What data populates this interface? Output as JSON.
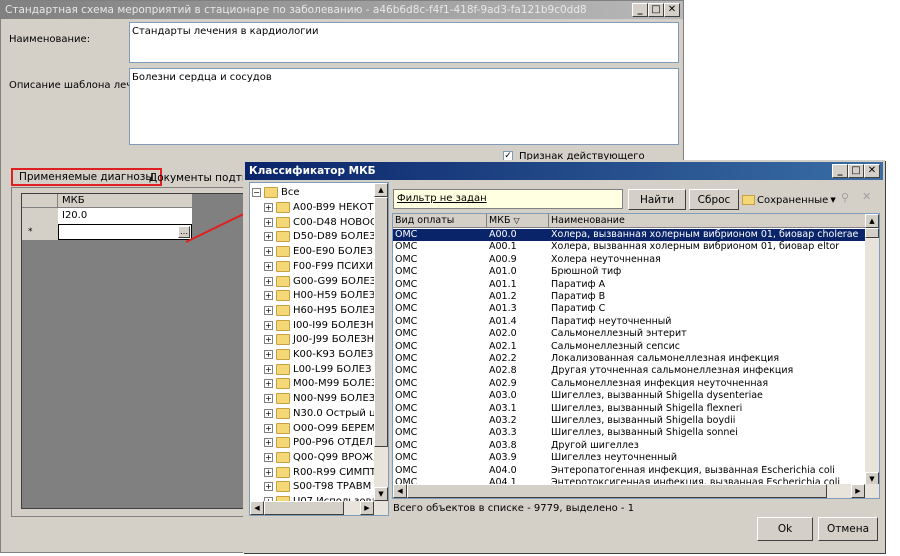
{
  "main_window": {
    "title": "Стандартная схема мероприятий в стационаре по заболеванию - a46b6d8c-f4f1-418f-9ad3-fa121b9c0dd8",
    "name_label": "Наименование:",
    "name_value": "Стандарты лечения в кардиологии",
    "desc_label": "Описание шаблона лечения:",
    "desc_value": "Болезни сердца и сосудов",
    "active_checkbox_label": "Признак действующего шаблона",
    "tabs": [
      "Применяемые диагнозы",
      "Документы подтверж"
    ],
    "grid_header": "МКБ",
    "grid_rows": [
      "I20.0"
    ],
    "new_row_marker": "*"
  },
  "dialog": {
    "title": "Классификатор МКБ",
    "tree_root": "Все",
    "tree_items": [
      "A00-B99 НЕКОТ",
      "C00-D48 НОВОО",
      "D50-D89 БОЛЕЗ",
      "E00-E90 БОЛЕЗ",
      "F00-F99 ПСИХИ",
      "G00-G99 БОЛЕЗ",
      "H00-H59 БОЛЕЗ",
      "H60-H95 БОЛЕЗ",
      "I00-I99 БОЛЕЗН",
      "J00-J99 БОЛЕЗН",
      "K00-K93 БОЛЕЗ",
      "L00-L99 БОЛЕЗ",
      "M00-M99 БОЛЕЗ",
      "N00-N99 БОЛЕЗ",
      "N30.0 Острый ц",
      "O00-O99 БЕРЕМ",
      "P00-P96 ОТДЕЛ",
      "Q00-Q99 ВРОЖ,",
      "R00-R99 СИМПТ",
      "S00-T98 ТРАВМ",
      "U07 Использова"
    ],
    "filter_text": "Фильтр не задан",
    "find_button": "Найти",
    "reset_button": "Сброс",
    "saved_button": "Сохраненные",
    "columns": [
      "Вид оплаты",
      "МКБ",
      "Наименование"
    ],
    "rows": [
      [
        "ОМС",
        "A00.0",
        "Холера, вызванная холерным вибрионом 01, биовар cholerae"
      ],
      [
        "ОМС",
        "A00.1",
        "Холера, вызванная холерным вибрионом 01, биовар eltor"
      ],
      [
        "ОМС",
        "A00.9",
        "Холера неуточненная"
      ],
      [
        "ОМС",
        "A01.0",
        "Брюшной тиф"
      ],
      [
        "ОМС",
        "A01.1",
        "Паратиф A"
      ],
      [
        "ОМС",
        "A01.2",
        "Паратиф B"
      ],
      [
        "ОМС",
        "A01.3",
        "Паратиф C"
      ],
      [
        "ОМС",
        "A01.4",
        "Паратиф неуточненный"
      ],
      [
        "ОМС",
        "A02.0",
        "Сальмонеллезный энтерит"
      ],
      [
        "ОМС",
        "A02.1",
        "Сальмонеллезный сепсис"
      ],
      [
        "ОМС",
        "A02.2",
        "Локализованная сальмонеллезная инфекция"
      ],
      [
        "ОМС",
        "A02.8",
        "Другая уточненная сальмонеллезная инфекция"
      ],
      [
        "ОМС",
        "A02.9",
        "Сальмонеллезная инфекция неуточненная"
      ],
      [
        "ОМС",
        "A03.0",
        "Шигеллез, вызванный Shigella dysenteriae"
      ],
      [
        "ОМС",
        "A03.1",
        "Шигеллез, вызванный Shigella flexneri"
      ],
      [
        "ОМС",
        "A03.2",
        "Шигеллез, вызванный Shigella boydii"
      ],
      [
        "ОМС",
        "A03.3",
        "Шигеллез, вызванный Shigella sonnei"
      ],
      [
        "ОМС",
        "A03.8",
        "Другой шигеллез"
      ],
      [
        "ОМС",
        "A03.9",
        "Шигеллез неуточненный"
      ],
      [
        "ОМС",
        "A04.0",
        "Энтеропатогенная инфекция, вызванная Escherichia coli"
      ],
      [
        "ОМС",
        "A04.1",
        "Энтеротоксигенная инфекция, вызванная Escherichia coli"
      ]
    ],
    "status": "Всего объектов в списке - 9779, выделено - 1",
    "ok_button": "Ok",
    "cancel_button": "Отмена"
  },
  "colors": {
    "active_title": "#0a246a",
    "selection": "#0a246a",
    "annotation": "#e02020"
  }
}
